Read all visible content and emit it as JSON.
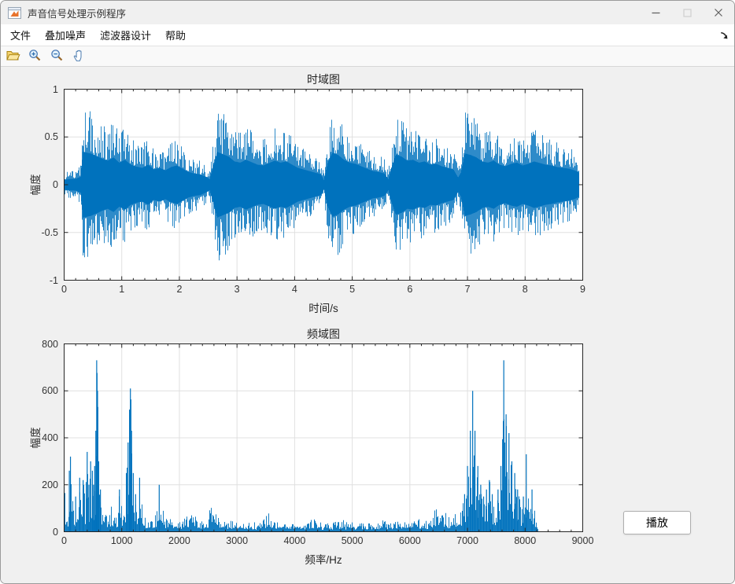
{
  "window": {
    "title": "声音信号处理示例程序"
  },
  "menu": {
    "items": [
      {
        "id": "file",
        "label": "文件"
      },
      {
        "id": "add-noise",
        "label": "叠加噪声"
      },
      {
        "id": "filter-design",
        "label": "滤波器设计"
      },
      {
        "id": "help",
        "label": "帮助"
      }
    ]
  },
  "toolbar": {
    "buttons": [
      {
        "id": "open-file",
        "icon": "folder-open-icon"
      },
      {
        "id": "zoom-in",
        "icon": "zoom-in-icon"
      },
      {
        "id": "zoom-out",
        "icon": "zoom-out-icon"
      },
      {
        "id": "pan",
        "icon": "hand-icon"
      }
    ]
  },
  "figure": {
    "background": "#f0f0f0",
    "play_button": {
      "label": "播放"
    }
  },
  "colors": {
    "line_blue": "#0072BD",
    "axis": "#262626",
    "grid": "#e0e0e0",
    "chrome_bg": "#f0f0f0"
  },
  "chart_data": [
    {
      "type": "line",
      "subtype": "audio-waveform",
      "title": "时域图",
      "xlabel": "时间/s",
      "ylabel": "幅度",
      "xlim": [
        0,
        9
      ],
      "ylim": [
        -1,
        1
      ],
      "xticks": [
        0,
        1,
        2,
        3,
        4,
        5,
        6,
        7,
        8,
        9
      ],
      "x_minor_step": 0.2,
      "yticks": [
        -1,
        -0.5,
        0,
        0.5,
        1
      ],
      "grid": true,
      "line_color": "#0072BD",
      "signal_end_s": 8.93,
      "envelope": [
        [
          0,
          0.13
        ],
        [
          0.1,
          0.14
        ],
        [
          0.2,
          0.15
        ],
        [
          0.28,
          0.2
        ],
        [
          0.32,
          0.82
        ],
        [
          0.45,
          0.78
        ],
        [
          0.55,
          0.72
        ],
        [
          0.65,
          0.65
        ],
        [
          0.75,
          0.6
        ],
        [
          0.85,
          0.68
        ],
        [
          0.95,
          0.55
        ],
        [
          1.05,
          0.62
        ],
        [
          1.15,
          0.5
        ],
        [
          1.25,
          0.45
        ],
        [
          1.35,
          0.42
        ],
        [
          1.45,
          0.5
        ],
        [
          1.55,
          0.38
        ],
        [
          1.65,
          0.42
        ],
        [
          1.75,
          0.36
        ],
        [
          1.85,
          0.44
        ],
        [
          1.95,
          0.48
        ],
        [
          2.05,
          0.4
        ],
        [
          2.15,
          0.32
        ],
        [
          2.25,
          0.28
        ],
        [
          2.35,
          0.26
        ],
        [
          2.45,
          0.2
        ],
        [
          2.52,
          0.14
        ],
        [
          2.58,
          0.45
        ],
        [
          2.65,
          0.82
        ],
        [
          2.75,
          0.76
        ],
        [
          2.85,
          0.7
        ],
        [
          2.95,
          0.58
        ],
        [
          3.05,
          0.55
        ],
        [
          3.15,
          0.62
        ],
        [
          3.25,
          0.56
        ],
        [
          3.35,
          0.5
        ],
        [
          3.45,
          0.48
        ],
        [
          3.55,
          0.54
        ],
        [
          3.65,
          0.6
        ],
        [
          3.75,
          0.55
        ],
        [
          3.85,
          0.58
        ],
        [
          3.95,
          0.5
        ],
        [
          4.05,
          0.42
        ],
        [
          4.15,
          0.38
        ],
        [
          4.25,
          0.34
        ],
        [
          4.35,
          0.3
        ],
        [
          4.45,
          0.26
        ],
        [
          4.5,
          0.12
        ],
        [
          4.57,
          0.55
        ],
        [
          4.65,
          0.8
        ],
        [
          4.75,
          0.74
        ],
        [
          4.85,
          0.62
        ],
        [
          4.95,
          0.55
        ],
        [
          5.05,
          0.52
        ],
        [
          5.15,
          0.46
        ],
        [
          5.25,
          0.4
        ],
        [
          5.35,
          0.34
        ],
        [
          5.45,
          0.32
        ],
        [
          5.55,
          0.28
        ],
        [
          5.62,
          0.14
        ],
        [
          5.68,
          0.45
        ],
        [
          5.75,
          0.75
        ],
        [
          5.85,
          0.7
        ],
        [
          5.95,
          0.6
        ],
        [
          6.05,
          0.62
        ],
        [
          6.15,
          0.55
        ],
        [
          6.25,
          0.58
        ],
        [
          6.35,
          0.5
        ],
        [
          6.45,
          0.52
        ],
        [
          6.55,
          0.46
        ],
        [
          6.65,
          0.42
        ],
        [
          6.75,
          0.38
        ],
        [
          6.83,
          0.18
        ],
        [
          6.88,
          0.3
        ],
        [
          6.95,
          0.78
        ],
        [
          7.05,
          0.74
        ],
        [
          7.15,
          0.68
        ],
        [
          7.25,
          0.58
        ],
        [
          7.35,
          0.55
        ],
        [
          7.45,
          0.6
        ],
        [
          7.55,
          0.5
        ],
        [
          7.65,
          0.46
        ],
        [
          7.75,
          0.52
        ],
        [
          7.85,
          0.55
        ],
        [
          7.95,
          0.48
        ],
        [
          8.05,
          0.52
        ],
        [
          8.15,
          0.58
        ],
        [
          8.25,
          0.54
        ],
        [
          8.35,
          0.5
        ],
        [
          8.45,
          0.48
        ],
        [
          8.55,
          0.44
        ],
        [
          8.65,
          0.42
        ],
        [
          8.75,
          0.4
        ],
        [
          8.85,
          0.36
        ],
        [
          8.93,
          0.3
        ]
      ]
    },
    {
      "type": "line",
      "subtype": "magnitude-spectrum",
      "title": "频域图",
      "xlabel": "频率/Hz",
      "ylabel": "幅度",
      "xlim": [
        0,
        9000
      ],
      "ylim": [
        0,
        800
      ],
      "xticks": [
        0,
        1000,
        2000,
        3000,
        4000,
        5000,
        6000,
        7000,
        8000,
        9000
      ],
      "x_minor_step": 200,
      "yticks": [
        0,
        200,
        400,
        600,
        800
      ],
      "grid": true,
      "line_color": "#0072BD",
      "cutoff_hz": 8230,
      "main_peaks": [
        [
          565,
          730
        ],
        [
          1150,
          610
        ],
        [
          7090,
          600
        ],
        [
          7630,
          730
        ]
      ],
      "spectrum_envelope": [
        [
          0,
          190
        ],
        [
          30,
          120
        ],
        [
          60,
          70
        ],
        [
          90,
          260
        ],
        [
          110,
          320
        ],
        [
          140,
          140
        ],
        [
          170,
          90
        ],
        [
          200,
          150
        ],
        [
          240,
          60
        ],
        [
          270,
          230
        ],
        [
          300,
          140
        ],
        [
          330,
          220
        ],
        [
          360,
          130
        ],
        [
          400,
          340
        ],
        [
          430,
          200
        ],
        [
          460,
          300
        ],
        [
          490,
          260
        ],
        [
          510,
          200
        ],
        [
          530,
          280
        ],
        [
          550,
          430
        ],
        [
          565,
          730
        ],
        [
          580,
          600
        ],
        [
          600,
          300
        ],
        [
          630,
          180
        ],
        [
          670,
          120
        ],
        [
          720,
          90
        ],
        [
          770,
          60
        ],
        [
          820,
          130
        ],
        [
          870,
          70
        ],
        [
          920,
          100
        ],
        [
          960,
          180
        ],
        [
          1000,
          90
        ],
        [
          1040,
          130
        ],
        [
          1080,
          250
        ],
        [
          1110,
          380
        ],
        [
          1135,
          520
        ],
        [
          1150,
          610
        ],
        [
          1170,
          430
        ],
        [
          1200,
          250
        ],
        [
          1240,
          160
        ],
        [
          1280,
          90
        ],
        [
          1310,
          230
        ],
        [
          1350,
          130
        ],
        [
          1400,
          60
        ],
        [
          1450,
          50
        ],
        [
          1500,
          80
        ],
        [
          1550,
          60
        ],
        [
          1600,
          90
        ],
        [
          1650,
          200
        ],
        [
          1700,
          130
        ],
        [
          1760,
          70
        ],
        [
          1820,
          60
        ],
        [
          1900,
          50
        ],
        [
          2000,
          45
        ],
        [
          2080,
          60
        ],
        [
          2150,
          90
        ],
        [
          2250,
          70
        ],
        [
          2350,
          55
        ],
        [
          2450,
          50
        ],
        [
          2550,
          110
        ],
        [
          2650,
          80
        ],
        [
          2750,
          55
        ],
        [
          2850,
          45
        ],
        [
          2950,
          50
        ],
        [
          3050,
          40
        ],
        [
          3150,
          35
        ],
        [
          3250,
          45
        ],
        [
          3350,
          40
        ],
        [
          3450,
          55
        ],
        [
          3520,
          90
        ],
        [
          3600,
          50
        ],
        [
          3700,
          40
        ],
        [
          3800,
          35
        ],
        [
          3900,
          40
        ],
        [
          4000,
          35
        ],
        [
          4100,
          30
        ],
        [
          4200,
          35
        ],
        [
          4300,
          60
        ],
        [
          4400,
          45
        ],
        [
          4500,
          40
        ],
        [
          4600,
          35
        ],
        [
          4700,
          45
        ],
        [
          4800,
          55
        ],
        [
          4900,
          45
        ],
        [
          5000,
          40
        ],
        [
          5100,
          35
        ],
        [
          5200,
          45
        ],
        [
          5300,
          40
        ],
        [
          5400,
          35
        ],
        [
          5500,
          55
        ],
        [
          5600,
          45
        ],
        [
          5700,
          40
        ],
        [
          5800,
          50
        ],
        [
          5900,
          45
        ],
        [
          6000,
          40
        ],
        [
          6100,
          50
        ],
        [
          6200,
          60
        ],
        [
          6300,
          55
        ],
        [
          6400,
          90
        ],
        [
          6450,
          130
        ],
        [
          6550,
          100
        ],
        [
          6650,
          70
        ],
        [
          6750,
          80
        ],
        [
          6850,
          110
        ],
        [
          6950,
          160
        ],
        [
          7000,
          280
        ],
        [
          7050,
          430
        ],
        [
          7090,
          600
        ],
        [
          7130,
          430
        ],
        [
          7180,
          280
        ],
        [
          7230,
          200
        ],
        [
          7280,
          150
        ],
        [
          7330,
          180
        ],
        [
          7380,
          220
        ],
        [
          7430,
          160
        ],
        [
          7480,
          130
        ],
        [
          7530,
          180
        ],
        [
          7580,
          280
        ],
        [
          7630,
          730
        ],
        [
          7670,
          500
        ],
        [
          7720,
          420
        ],
        [
          7770,
          300
        ],
        [
          7820,
          250
        ],
        [
          7870,
          180
        ],
        [
          7920,
          120
        ],
        [
          7970,
          150
        ],
        [
          8020,
          330
        ],
        [
          8070,
          120
        ],
        [
          8120,
          180
        ],
        [
          8170,
          100
        ],
        [
          8200,
          30
        ],
        [
          8230,
          0
        ],
        [
          9000,
          0
        ]
      ]
    }
  ]
}
